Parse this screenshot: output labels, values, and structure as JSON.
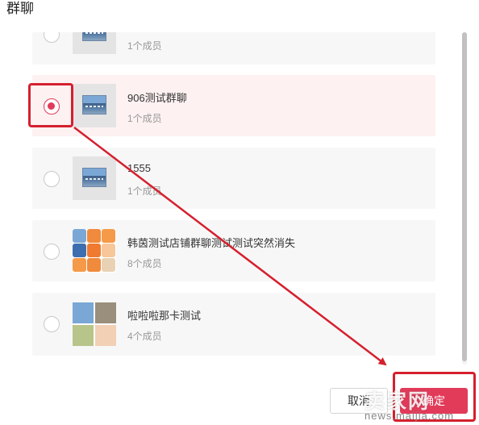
{
  "dialog": {
    "title": "群聊"
  },
  "groups": [
    {
      "name": "",
      "members": "1个成员",
      "selected": false
    },
    {
      "name": "906测试群聊",
      "members": "1个成员",
      "selected": true
    },
    {
      "name": "1555",
      "members": "1个成员",
      "selected": false
    },
    {
      "name": "韩茵测试店铺群聊测试测试突然消失",
      "members": "8个成员",
      "selected": false
    },
    {
      "name": "啦啦啦那卡测试",
      "members": "4个成员",
      "selected": false
    }
  ],
  "footer": {
    "cancel_label": "取消",
    "confirm_label": "确定"
  },
  "watermark": {
    "main": "卖家网",
    "sub": "news.maijia.com"
  },
  "colors": {
    "accent": "#e23b5a",
    "annotation": "#d5202e",
    "selected_bg": "#fdf1f1"
  }
}
